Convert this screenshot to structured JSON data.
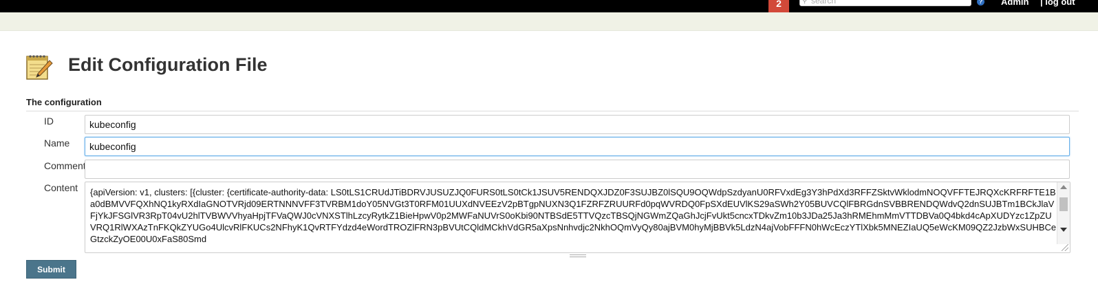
{
  "topbar": {
    "notification_count": "2",
    "search_placeholder": "search",
    "help_icon": "help-icon",
    "user_label": "Admin",
    "logout_label": "| log out"
  },
  "header": {
    "title": "Edit Configuration File",
    "icon": "notepad-pencil-icon"
  },
  "section": {
    "title": "The configuration"
  },
  "form": {
    "id_label": "ID",
    "id_value": "kubeconfig",
    "name_label": "Name",
    "name_value": "kubeconfig",
    "comment_label": "Comment",
    "comment_value": "",
    "content_label": "Content",
    "content_value": "{apiVersion: v1, clusters: [{cluster: {certificate-authority-data: LS0tLS1CRUdJTiBDRVJUSUZJQ0FURS0tLS0tCk1JSUV5RENDQXJDZ0F3SUJBZ0lSQU9OQWdpSzdyanU0RFVxdEg3Y3hPdXd3RFFZSktvWklodmNOQVFFTEJRQXcKRFRFTE1Ba0dBMVVFQXhNQ1kyRXdIaGNOTVRjd09ERTNNNVFF3TVRBM1doY05NVGt3T0RFM01UUXdNVEEzV2pBTgpNUXN3Q1FZRFZRUURFd0pqWVRDQ0FpSXdEUVlKS29aSWh2Y05BUVCQlFBRGdnSVBBRENDQWdvQ2dnSUJBTm1BCkJlaVFjYkJFSGlVR3RpT04vU2hlTVBWVVhyaHpjTFVaQWJ0cVNXSTlhLzcyRytkZ1BieHpwV0p2MWFaNUVrS0oKbi90NTBSdE5TTVQzcTBSQjNGWmZQaGhJcjFvUkt5cncxTDkvZm10b3JDa25Ja3hRMEhmMmVTTDBVa0Q4bkd4cApXUDYzc1ZpZUVRQ1RlWXAzTnFKQkZYUGo4UlcvRlFKUCs2NFhyK1QvRTFYdzd4eWordTROZlFRN3pBVUtCQldMCkhVdGR5aXpsNnhvdjc2NkhOQmVyQy80ajBVM0hyMjBBVk5LdzN4ajVobFFFN0hWcEczYTlXbk5MNEZIaUQ5eWcKM09QZ2JzbWxSUHBCeGtzckZyOE00U0xFaS80Smd"
  },
  "actions": {
    "submit_label": "Submit"
  }
}
